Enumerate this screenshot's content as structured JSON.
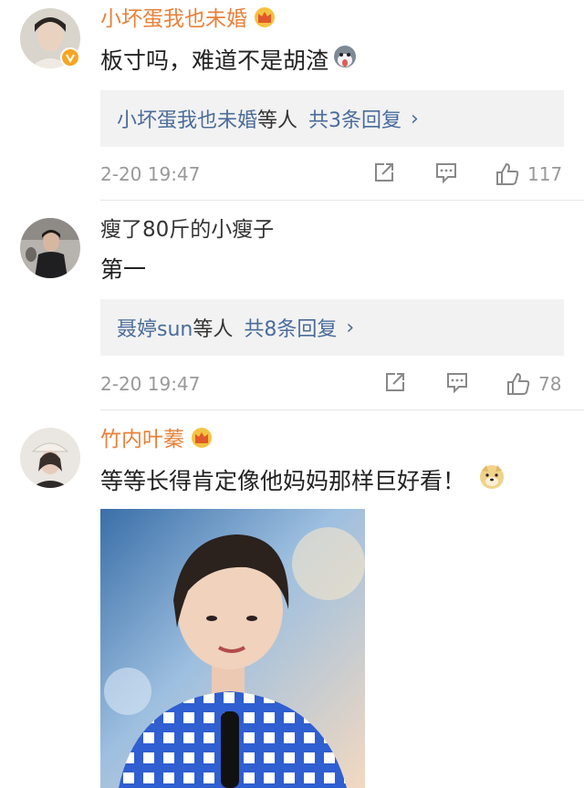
{
  "comments": [
    {
      "username": "小坏蛋我也未婚",
      "text": "板寸吗，难道不是胡渣",
      "reply_who": "小坏蛋我也未婚",
      "reply_rest": "等人",
      "reply_count": "共3条回复",
      "reply_chevron": "›",
      "timestamp": "2-20 19:47",
      "likes": "117",
      "avatar_icon": "portrait-avatar",
      "vip_icon": "crown-icon",
      "emoji_icon": "husky-face-icon",
      "name_color": "#e8813a"
    },
    {
      "username": "瘦了80斤的小瘦子",
      "text": "第一",
      "reply_who": "聂婷sun",
      "reply_rest": "等人",
      "reply_count": "共8条回复",
      "reply_chevron": "›",
      "timestamp": "2-20 19:47",
      "likes": "78",
      "avatar_icon": "portrait-avatar",
      "name_color": "#333333"
    },
    {
      "username": "竹内叶蓁",
      "text": "等等长得肯定像他妈妈那样巨好看！",
      "avatar_icon": "portrait-avatar",
      "vip_icon": "crown-icon",
      "emoji_icon": "doge-face-icon",
      "name_color": "#e8813a"
    }
  ],
  "colors": {
    "link": "#4a6c9b",
    "meta": "#999999",
    "reply_bg": "#f2f2f2",
    "vip_gold": "#f5a623"
  }
}
